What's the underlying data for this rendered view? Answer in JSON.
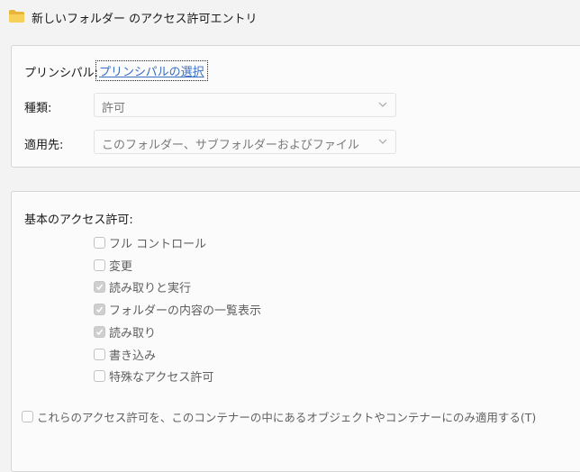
{
  "window": {
    "title": "新しいフォルダー のアクセス許可エントリ",
    "icon": "folder-icon"
  },
  "principal": {
    "label": "プリンシパル:",
    "link": "プリンシパルの選択"
  },
  "type": {
    "label": "種類:",
    "value": "許可"
  },
  "applies_to": {
    "label": "適用先:",
    "value": "このフォルダー、サブフォルダーおよびファイル"
  },
  "basic_permissions": {
    "label": "基本のアクセス許可:",
    "items": [
      {
        "label": "フル コントロール",
        "checked": false
      },
      {
        "label": "変更",
        "checked": false
      },
      {
        "label": "読み取りと実行",
        "checked": true
      },
      {
        "label": "フォルダーの内容の一覧表示",
        "checked": true
      },
      {
        "label": "読み取り",
        "checked": true
      },
      {
        "label": "書き込み",
        "checked": false
      },
      {
        "label": "特殊なアクセス許可",
        "checked": false
      }
    ]
  },
  "apply_only": {
    "label": "これらのアクセス許可を、このコンテナーの中にあるオブジェクトやコンテナーにのみ適用する(T)",
    "checked": false
  },
  "colors": {
    "folder": "#f2c744",
    "link": "#3a6fc4",
    "disabled_text": "#5f5f5f"
  }
}
